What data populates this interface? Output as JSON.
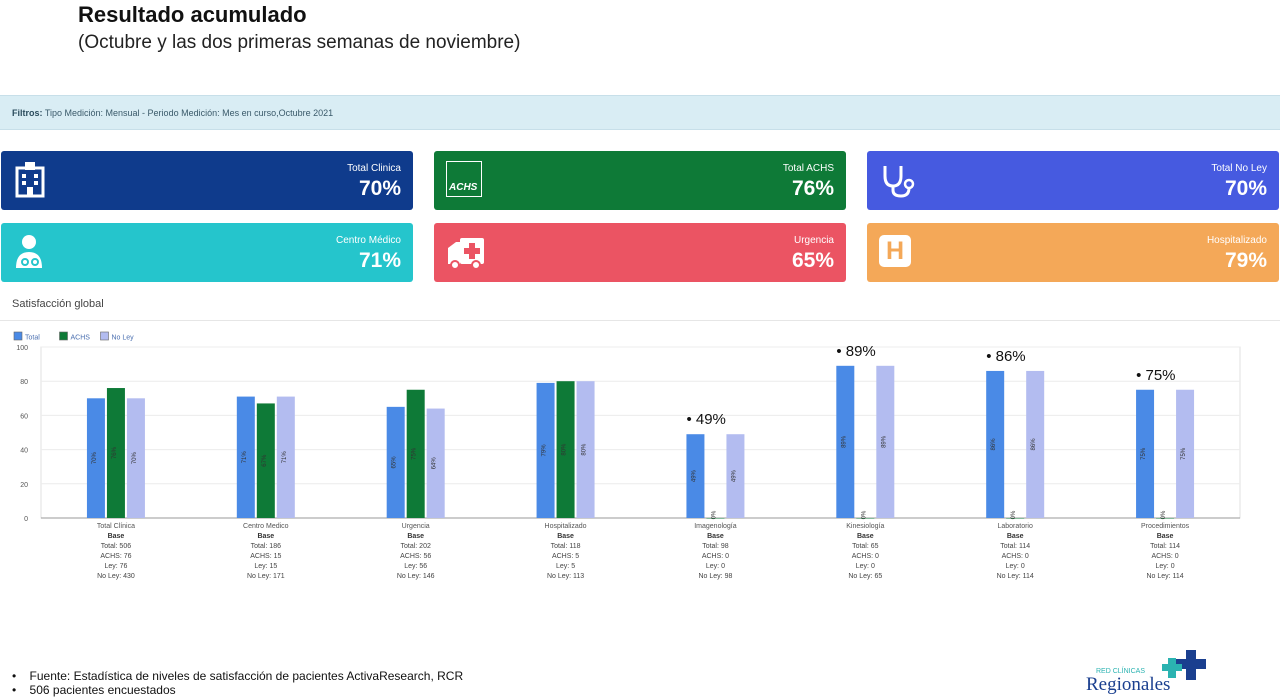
{
  "header": {
    "title": "Resultado acumulado",
    "subtitle": "(Octubre y las dos primeras semanas de noviembre)"
  },
  "filters": {
    "label": "Filtros:",
    "text": "Tipo Medición: Mensual - Periodo Medición: Mes en curso,Octubre 2021"
  },
  "cards": [
    {
      "label": "Total Clinica",
      "value": "70%",
      "color": "#0f3b8c",
      "icon": "hospital-building-icon"
    },
    {
      "label": "Total ACHS",
      "value": "76%",
      "color": "#0e7a37",
      "icon": "achs-logo-icon",
      "icon_text": "ACHS"
    },
    {
      "label": "Total No Ley",
      "value": "70%",
      "color": "#465ae0",
      "icon": "stethoscope-icon"
    },
    {
      "label": "Centro Médico",
      "value": "71%",
      "color": "#25c5cc",
      "icon": "doctor-icon"
    },
    {
      "label": "Urgencia",
      "value": "65%",
      "color": "#eb5463",
      "icon": "ambulance-icon"
    },
    {
      "label": "Hospitalizado",
      "value": "79%",
      "color": "#f4a858",
      "icon": "hospital-h-icon",
      "icon_text": "H"
    }
  ],
  "chart_panel": {
    "title": "Satisfacción global"
  },
  "chart_data": {
    "type": "bar",
    "ylim": [
      0,
      100
    ],
    "yticks": [
      0,
      20,
      40,
      60,
      80,
      100
    ],
    "legend_position": "top-left",
    "categories": [
      "Total Clínica",
      "Centro Medico",
      "Urgencia",
      "Hospitalizado",
      "Imagenología",
      "Kinesiología",
      "Laboratorio",
      "Procedimientos"
    ],
    "series": [
      {
        "name": "Total",
        "color": "#4a8ae6",
        "values": [
          70,
          71,
          65,
          79,
          49,
          89,
          86,
          75
        ],
        "labels": [
          "70%",
          "71%",
          "65%",
          "79%",
          "49%",
          "89%",
          "86%",
          "75%"
        ]
      },
      {
        "name": "ACHS",
        "color": "#0e7a37",
        "values": [
          76,
          67,
          75,
          80,
          0,
          0,
          0,
          0
        ],
        "labels": [
          "76%",
          "67%",
          "75%",
          "80%",
          "0%",
          "0%",
          "0%",
          "0%"
        ]
      },
      {
        "name": "No Ley",
        "color": "#b3bcf0",
        "values": [
          70,
          71,
          64,
          80,
          49,
          89,
          86,
          75
        ],
        "labels": [
          "70%",
          "71%",
          "64%",
          "80%",
          "49%",
          "89%",
          "86%",
          "75%"
        ]
      }
    ],
    "base_title": "Base",
    "base": [
      [
        "Total: 506",
        "ACHS: 76",
        "Ley: 76",
        "No Ley: 430"
      ],
      [
        "Total: 186",
        "ACHS: 15",
        "Ley: 15",
        "No Ley: 171"
      ],
      [
        "Total: 202",
        "ACHS: 56",
        "Ley: 56",
        "No Ley: 146"
      ],
      [
        "Total: 118",
        "ACHS: 5",
        "Ley: 5",
        "No Ley: 113"
      ],
      [
        "Total: 98",
        "ACHS: 0",
        "Ley: 0",
        "No Ley: 98"
      ],
      [
        "Total: 65",
        "ACHS: 0",
        "Ley: 0",
        "No Ley: 65"
      ],
      [
        "Total: 114",
        "ACHS: 0",
        "Ley: 0",
        "No Ley: 114"
      ],
      [
        "Total: 114",
        "ACHS: 0",
        "Ley: 0",
        "No Ley: 114"
      ]
    ],
    "annotations": [
      {
        "category_index": 4,
        "text": "• 49%"
      },
      {
        "category_index": 5,
        "text": "• 89%"
      },
      {
        "category_index": 6,
        "text": "• 86%"
      },
      {
        "category_index": 7,
        "text": "• 75%"
      }
    ]
  },
  "footer": {
    "line1": "Fuente: Estadística de niveles de satisfacción de pacientes ActivaResearch, RCR",
    "line2": "506 pacientes encuestados",
    "logo_top": "RED CLÍNICAS",
    "logo_main": "Regionales"
  }
}
